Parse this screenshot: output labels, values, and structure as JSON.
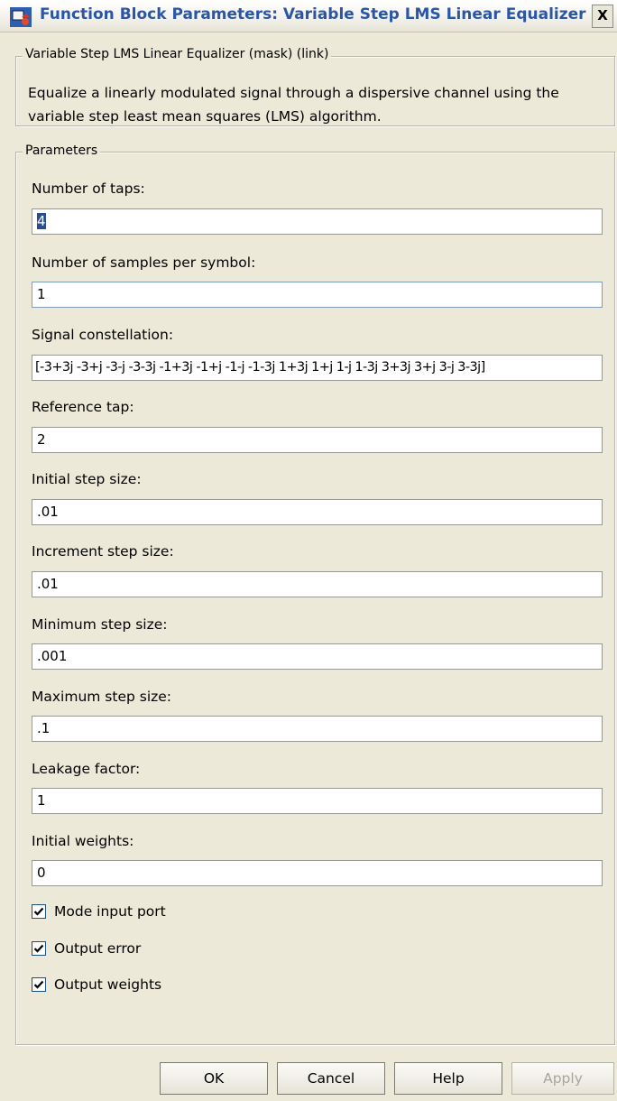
{
  "window": {
    "title": "Function Block Parameters: Variable Step LMS Linear Equalizer",
    "close_glyph": "X"
  },
  "mask": {
    "legend": "Variable Step LMS Linear Equalizer (mask) (link)",
    "description": "Equalize a linearly modulated signal through a dispersive channel using the variable step least mean squares (LMS) algorithm."
  },
  "parameters": {
    "legend": "Parameters",
    "fields": [
      {
        "label": "Number of taps:",
        "value": "4"
      },
      {
        "label": "Number of samples per symbol:",
        "value": "1"
      },
      {
        "label": "Signal constellation:",
        "value": "[-3+3j -3+j -3-j -3-3j -1+3j -1+j -1-j -1-3j 1+3j 1+j 1-j 1-3j 3+3j 3+j 3-j 3-3j]"
      },
      {
        "label": "Reference tap:",
        "value": "2"
      },
      {
        "label": "Initial step size:",
        "value": ".01"
      },
      {
        "label": "Increment step size:",
        "value": ".01"
      },
      {
        "label": "Minimum step size:",
        "value": ".001"
      },
      {
        "label": "Maximum step size:",
        "value": ".1"
      },
      {
        "label": "Leakage factor:",
        "value": "1"
      },
      {
        "label": "Initial weights:",
        "value": "0"
      }
    ],
    "checkboxes": [
      {
        "label": "Mode input port",
        "checked": true
      },
      {
        "label": "Output error",
        "checked": true
      },
      {
        "label": "Output weights",
        "checked": true
      }
    ]
  },
  "buttons": {
    "ok": "OK",
    "cancel": "Cancel",
    "help": "Help",
    "apply": "Apply"
  },
  "colors": {
    "background": "#ece9d8",
    "title_text": "#2a56a8",
    "selection": "#2a4d8f"
  }
}
